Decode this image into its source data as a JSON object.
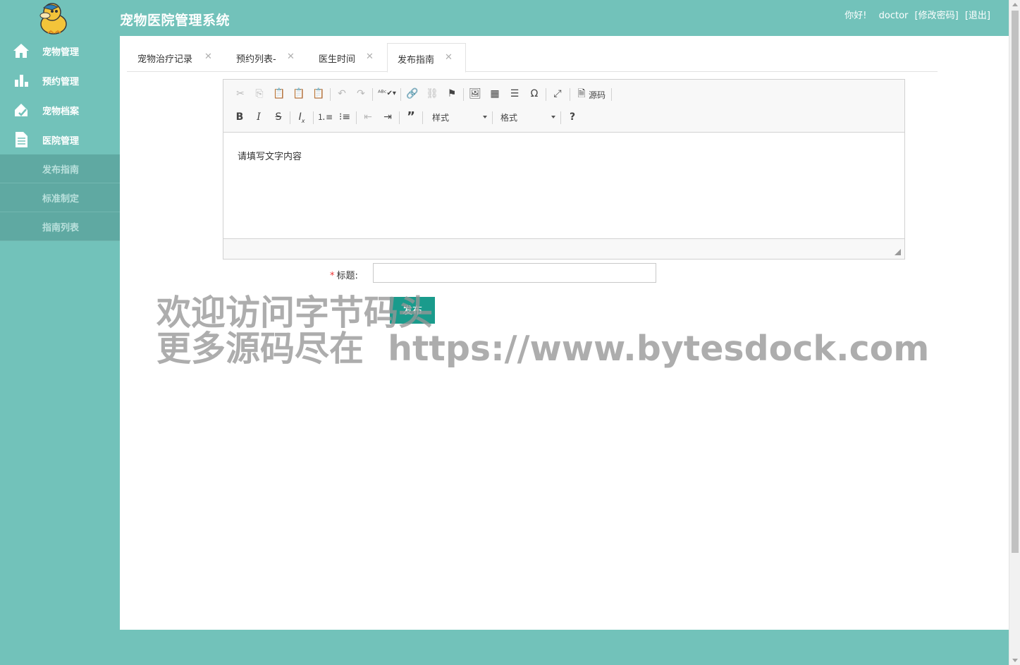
{
  "header": {
    "title": "宠物医院管理系统",
    "greeting": "你好!",
    "username": "doctor",
    "change_password": "[修改密码]",
    "logout": "[退出]"
  },
  "sidebar": {
    "items": [
      {
        "label": "宠物管理",
        "icon": "home-icon"
      },
      {
        "label": "预约管理",
        "icon": "bar-chart-icon"
      },
      {
        "label": "宠物档案",
        "icon": "pet-profile-icon"
      },
      {
        "label": "医院管理",
        "icon": "document-icon"
      }
    ],
    "subitems": [
      {
        "label": "发布指南"
      },
      {
        "label": "标准制定"
      },
      {
        "label": "指南列表"
      }
    ]
  },
  "tabs": [
    {
      "label": "宠物治疗记录",
      "close": "✕"
    },
    {
      "label": "预约列表-",
      "close": "✕"
    },
    {
      "label": "医生时间",
      "close": "✕"
    },
    {
      "label": "发布指南",
      "close": "✕",
      "active": true
    }
  ],
  "editor": {
    "content": "请填写文字内容",
    "style_combo": "样式",
    "format_combo": "格式",
    "source_label": "源码"
  },
  "form": {
    "required_mark": "*",
    "title_label": "标题:",
    "title_value": "",
    "submit_label": "发布"
  },
  "watermark": {
    "line1": "欢迎访问字节码头",
    "line2": "更多源码尽在  https://www.bytesdock.com"
  },
  "colors": {
    "primary": "#72c2ba",
    "submenu": "#5fa9a2",
    "button": "#1a9b8c"
  }
}
